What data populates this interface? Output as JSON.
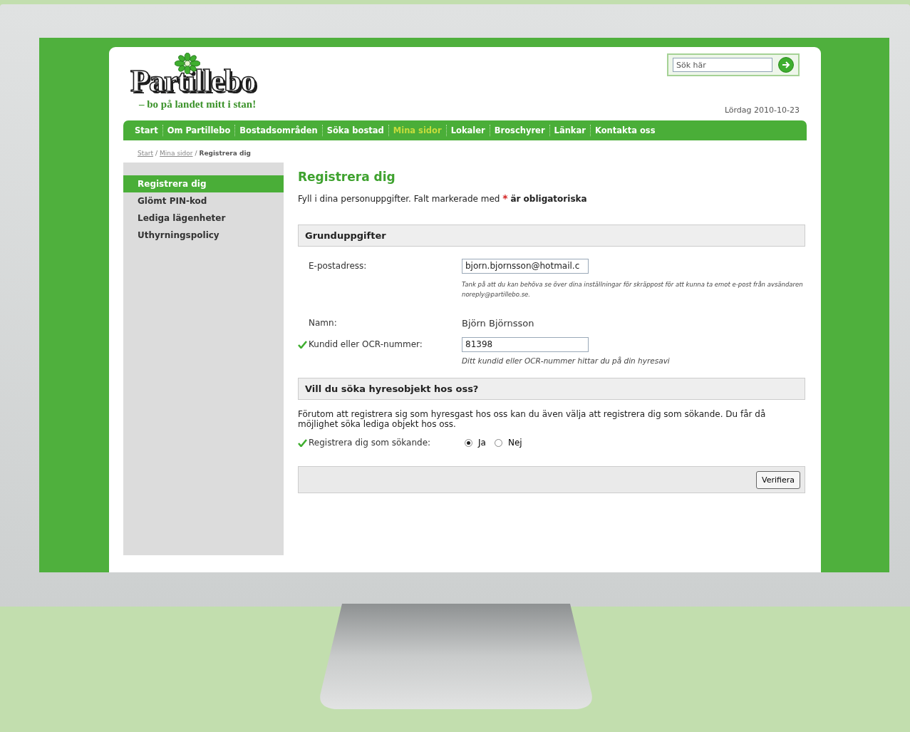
{
  "logo": {
    "name": "Partillebo",
    "tagline": "– bo på landet mitt i stan!"
  },
  "search": {
    "placeholder": "Sök här"
  },
  "date": "Lördag 2010-10-23",
  "nav": [
    {
      "label": "Start",
      "selected": false
    },
    {
      "label": "Om Partillebo",
      "selected": false
    },
    {
      "label": "Bostadsområden",
      "selected": false
    },
    {
      "label": "Söka bostad",
      "selected": false
    },
    {
      "label": "Mina sidor",
      "selected": true
    },
    {
      "label": "Lokaler",
      "selected": false
    },
    {
      "label": "Broschyrer",
      "selected": false
    },
    {
      "label": "Länkar",
      "selected": false
    },
    {
      "label": "Kontakta oss",
      "selected": false
    }
  ],
  "breadcrumb": [
    {
      "label": "Start",
      "link": true
    },
    {
      "label": "Mina sidor",
      "link": true
    },
    {
      "label": "Registrera dig",
      "link": false
    }
  ],
  "breadcrumb_separator": "/",
  "sidebar": {
    "items": [
      {
        "label": "Registrera dig",
        "selected": true
      },
      {
        "label": "Glömt PIN-kod",
        "selected": false
      },
      {
        "label": "Lediga lägenheter",
        "selected": false
      },
      {
        "label": "Uthyrningspolicy",
        "selected": false
      }
    ]
  },
  "form": {
    "title": "Registrera dig",
    "intro": {
      "text": "Fyll i dina personuppgifter. Falt markerade med",
      "required_mark": "*",
      "emphasis": "är obligatoriska"
    },
    "sections": [
      {
        "heading": "Grunduppgifter",
        "rows": [
          {
            "kind": "input",
            "label": "E-postadress:",
            "value": "bjorn.bjornsson@hotmail.c",
            "valid": false,
            "hint": "Tank på att du kan behöva se över dina inställningar för skräppost för att kunna ta emot e-post från avsändaren noreply@partillebo.se."
          },
          {
            "kind": "text",
            "label": "Namn:",
            "value": "Björn Björnsson",
            "valid": false
          },
          {
            "kind": "input",
            "label": "Kundid eller OCR-nummer:",
            "value": "81398",
            "valid": true,
            "hint": "Ditt kundid eller OCR-nummer hittar du på din hyresavi"
          }
        ]
      },
      {
        "heading": "Vill du söka hyresobjekt hos oss?",
        "description": "Förutom att registrera sig som hyresgast hos oss kan du även välja att registrera dig som sökande. Du får då möjlighet söka lediga objekt hos oss.",
        "rows": [
          {
            "kind": "radio",
            "label": "Registrera dig som sökande:",
            "valid": true,
            "options": [
              {
                "label": "Ja",
                "selected": true
              },
              {
                "label": "Nej",
                "selected": false
              }
            ]
          }
        ]
      }
    ],
    "submit": "Verifiera"
  }
}
